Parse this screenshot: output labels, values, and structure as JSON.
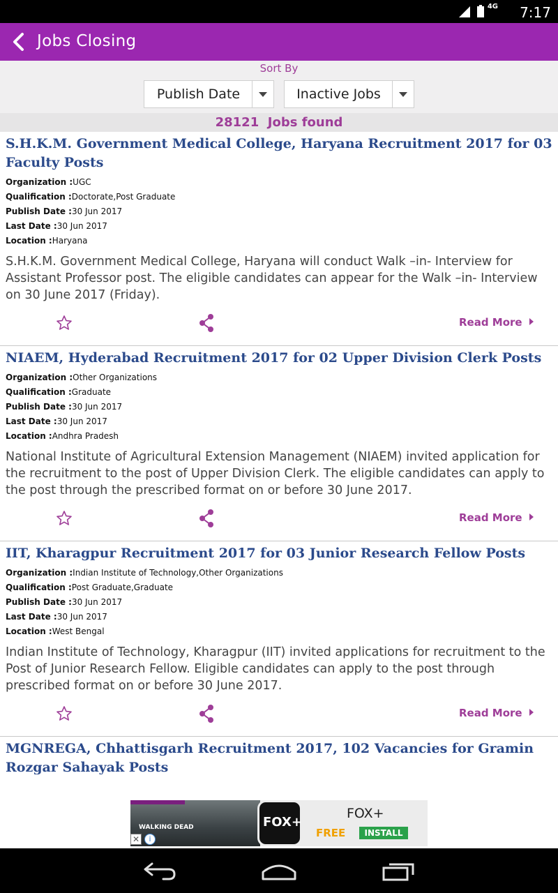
{
  "status": {
    "network": "4G",
    "time": "7:17"
  },
  "appbar": {
    "title": "Jobs Closing"
  },
  "sort": {
    "label": "Sort By",
    "sort_value": "Publish Date",
    "filter_value": "Inactive Jobs"
  },
  "results": {
    "count": "28121",
    "label": "Jobs found"
  },
  "labels": {
    "organization": "Organization :",
    "qualification": "Qualification :",
    "publish_date": "Publish Date :",
    "last_date": "Last Date :",
    "location": "Location :",
    "read_more": "Read More"
  },
  "jobs": [
    {
      "title": "S.H.K.M. Government Medical College, Haryana Recruitment 2017 for 03 Faculty Posts",
      "organization": "UGC",
      "qualification": "Doctorate,Post Graduate",
      "publish_date": "30 Jun 2017",
      "last_date": "30 Jun 2017",
      "location": "Haryana",
      "description": "S.H.K.M. Government Medical College, Haryana will conduct Walk –in- Interview for Assistant Professor post. The eligible candidates can appear for the Walk –in- Interview on 30 June 2017 (Friday)."
    },
    {
      "title": "NIAEM, Hyderabad Recruitment 2017 for 02 Upper Division Clerk Posts",
      "organization": "Other Organizations",
      "qualification": "Graduate",
      "publish_date": "30 Jun 2017",
      "last_date": "30 Jun 2017",
      "location": "Andhra Pradesh",
      "description": "National Institute of Agricultural Extension Management (NIAEM) invited application for the recruitment to the post of Upper Division Clerk. The eligible candidates can apply to the post through the prescribed format on or before 30 June 2017."
    },
    {
      "title": "IIT, Kharagpur Recruitment 2017 for 03 Junior Research Fellow Posts",
      "organization": "Indian Institute of Technology,Other Organizations",
      "qualification": "Post Graduate,Graduate",
      "publish_date": "30 Jun 2017",
      "last_date": "30 Jun 2017",
      "location": "West Bengal",
      "description": "Indian Institute of Technology, Kharagpur (IIT) invited applications for recruitment to the Post of Junior Research Fellow. Eligible candidates can apply to the post through prescribed format on or before 30 June 2017."
    },
    {
      "title": "MGNREGA, Chhattisgarh Recruitment 2017, 102 Vacancies for Gramin Rozgar Sahayak Posts"
    }
  ],
  "ad": {
    "image_text": "WALKING DEAD",
    "logo_text": "FOX+",
    "app_name": "FOX+",
    "price": "FREE",
    "install_label": "INSTALL",
    "close_glyph": "✕",
    "info_glyph": "i"
  },
  "colors": {
    "primary": "#9b27b0",
    "accent": "#9e3d98",
    "title": "#2b4a8b"
  },
  "icons": [
    "back-arrow-icon",
    "star-icon",
    "share-icon",
    "nav-back-icon",
    "nav-home-icon",
    "nav-recents-icon"
  ]
}
